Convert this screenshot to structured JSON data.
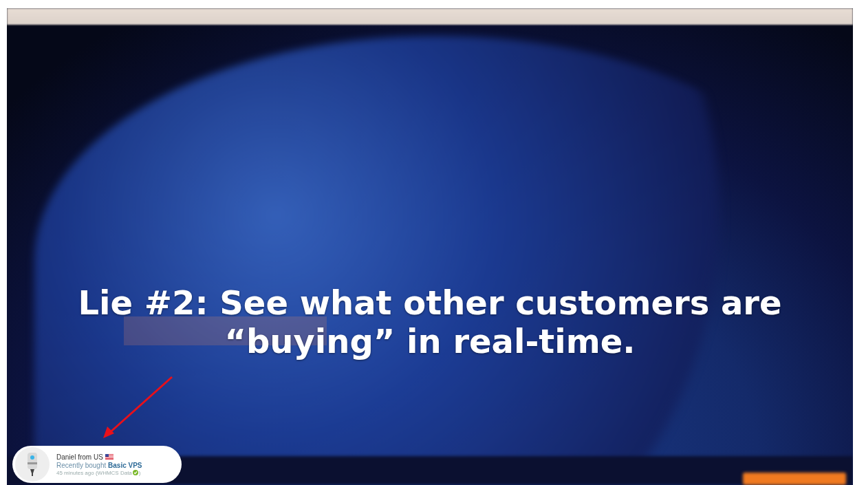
{
  "caption": {
    "lines": [
      "Lie #2: See what other customers are",
      "“buying” in real-time."
    ]
  },
  "purchase_popup": {
    "buyer": "Daniel from US",
    "action": "Recently bought **Basic VPS**",
    "time_before": "45 minutes ago (WHMCS Data",
    "time_after": ")"
  }
}
